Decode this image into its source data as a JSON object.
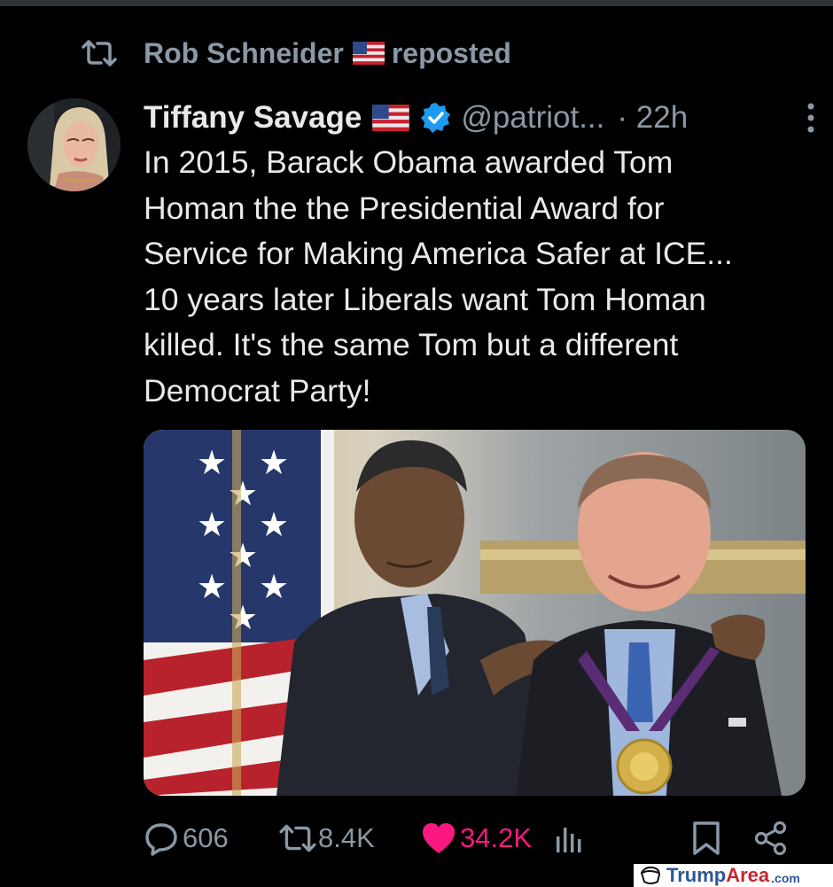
{
  "repost": {
    "user": "Rob Schneider",
    "label": "reposted",
    "icon": "repost-icon"
  },
  "tweet": {
    "display_name": "Tiffany Savage",
    "handle": "@patriot...",
    "time": "· 22h",
    "verified_icon": "verified-badge-icon",
    "flag_icon": "us-flag-icon",
    "lines": [
      "In 2015, Barack Obama awarded Tom",
      "Homan the the Presidential Award for",
      "Service for Making America Safer at ICE...",
      "10 years later Liberals want Tom Homan",
      "killed. It's the same Tom but a different",
      "Democrat Party!"
    ]
  },
  "actions": {
    "replies": "606",
    "reposts": "8.4K",
    "likes": "34.2K"
  },
  "watermark": {
    "part1": "Trump",
    "part2": "Area",
    "part3": ".com"
  },
  "colors": {
    "background": "#000000",
    "text": "#e7e9ea",
    "muted": "#8b98a5",
    "like": "#f91880",
    "verified": "#1d9bf0"
  }
}
